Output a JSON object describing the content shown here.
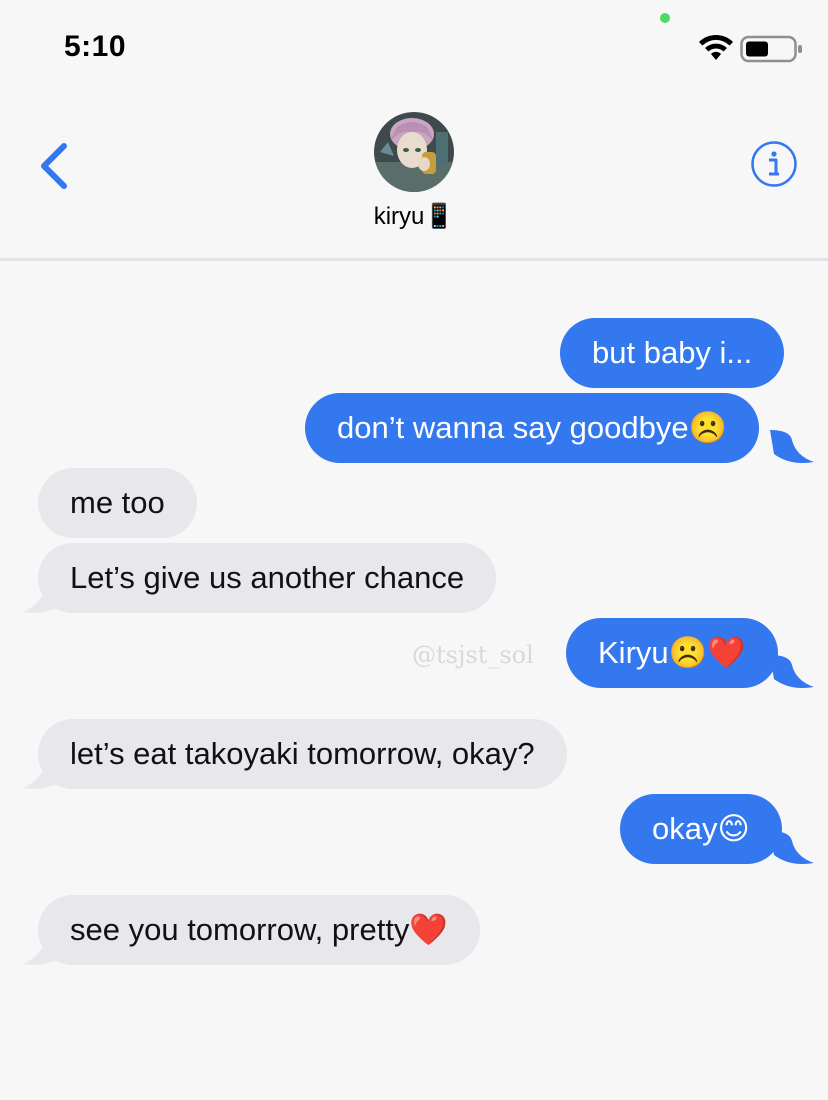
{
  "status_bar": {
    "time": "5:10"
  },
  "header": {
    "contact_name": "kiryu📱"
  },
  "watermark": "@tsjst_sol",
  "messages": [
    {
      "side": "sent",
      "text": "but baby i..."
    },
    {
      "side": "sent",
      "text": "don’t wanna say goodbye☹️"
    },
    {
      "side": "received",
      "text": "me too"
    },
    {
      "side": "received",
      "text": "Let’s give us another chance"
    },
    {
      "side": "sent",
      "text": "Kiryu☹️❤️"
    },
    {
      "side": "received",
      "text": "let’s eat takoyaki tomorrow, okay?"
    },
    {
      "side": "sent",
      "text": "okay😊"
    },
    {
      "side": "received",
      "text": "see you tomorrow, pretty❤️"
    }
  ],
  "colors": {
    "sent_bubble": "#3478f0",
    "received_bubble": "#e7e7ec",
    "accent": "#3478f0"
  }
}
